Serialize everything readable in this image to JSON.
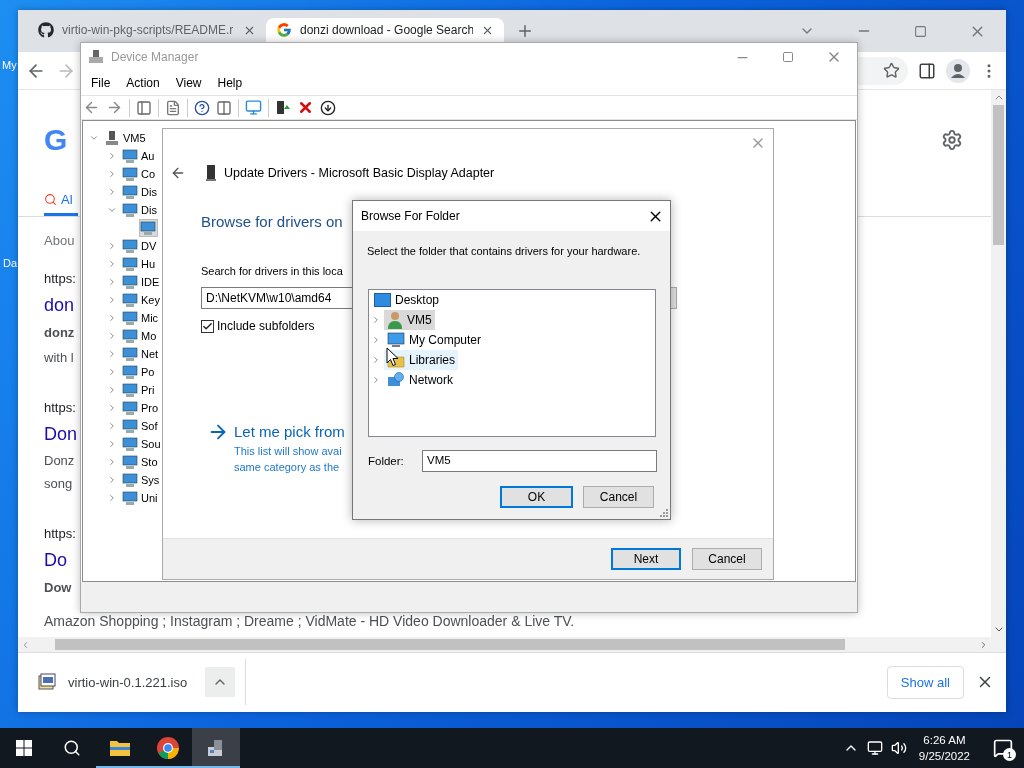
{
  "desktop_labels": [
    "My",
    "Da"
  ],
  "browser": {
    "tabs": [
      {
        "kind": "github",
        "title": "virtio-win-pkg-scripts/README.r",
        "selected": false
      },
      {
        "kind": "google",
        "title": "donzi download - Google Search",
        "selected": true
      }
    ],
    "page": {
      "logo": "G",
      "search_tab": {
        "label": "Al",
        "selected": true
      },
      "lines": [
        {
          "kind": "stats",
          "text": "Abou"
        },
        {
          "kind": "url",
          "text": "https:"
        },
        {
          "kind": "title",
          "text": "don"
        },
        {
          "kind": "bold",
          "text": "donz"
        },
        {
          "kind": "snippet",
          "text": "with l"
        },
        {
          "kind": "url",
          "text": "https:"
        },
        {
          "kind": "title",
          "text": "Don"
        },
        {
          "kind": "snippet",
          "text": "Donz"
        },
        {
          "kind": "snippet",
          "text": "song"
        },
        {
          "kind": "url",
          "text": "https:"
        },
        {
          "kind": "title",
          "text": "Do"
        },
        {
          "kind": "bold",
          "text": "Dow"
        }
      ],
      "wide_snippet": "Amazon Shopping ; Instagram ; Dreame ; VidMate - HD Video Downloader & Live TV."
    },
    "download": {
      "file": "virtio-win-0.1.221.iso",
      "show_all": "Show all"
    }
  },
  "device_manager": {
    "title": "Device Manager",
    "menu": [
      "File",
      "Action",
      "View",
      "Help"
    ],
    "tree": {
      "label": "VM5",
      "expanded": true,
      "children": [
        {
          "label": "Au",
          "expanded": false
        },
        {
          "label": "Co",
          "expanded": false
        },
        {
          "label": "Dis",
          "expanded": false
        },
        {
          "label": "Dis",
          "expanded": true,
          "children": [
            {
              "selected": true
            }
          ]
        },
        {
          "label": "DV",
          "expanded": false
        },
        {
          "label": "Hu",
          "expanded": false
        },
        {
          "label": "IDE",
          "expanded": false
        },
        {
          "label": "Key",
          "expanded": false
        },
        {
          "label": "Mic",
          "expanded": false
        },
        {
          "label": "Mo",
          "expanded": false
        },
        {
          "label": "Net",
          "expanded": false
        },
        {
          "label": "Po",
          "expanded": false
        },
        {
          "label": "Pri",
          "expanded": false
        },
        {
          "label": "Pro",
          "expanded": false
        },
        {
          "label": "Sof",
          "expanded": false
        },
        {
          "label": "Sou",
          "expanded": false
        },
        {
          "label": "Sto",
          "expanded": false
        },
        {
          "label": "Sys",
          "expanded": false
        },
        {
          "label": "Uni",
          "expanded": false
        }
      ]
    }
  },
  "update_drivers": {
    "title": "Update Drivers - Microsoft Basic Display Adapter",
    "heading": "Browse for drivers on",
    "location_label": "Search for drivers in this loca",
    "location": "D:\\NetKVM\\w10\\amd64",
    "include_subfolders": {
      "label": "Include subfolders",
      "checked": true
    },
    "pick_link": "Let me pick from",
    "pick_note": [
      "This list will show avai",
      "same category as the"
    ],
    "buttons": [
      {
        "label": "Next",
        "default": true
      },
      {
        "label": "Cancel",
        "default": false
      }
    ]
  },
  "browse_for_folder": {
    "title": "Browse For Folder",
    "instruction": "Select the folder that contains drivers for your hardware.",
    "items": [
      {
        "kind": "desktop",
        "label": "Desktop",
        "selected": false,
        "hovered": false
      },
      {
        "kind": "user",
        "label": "VM5",
        "expanded": false,
        "selected": true,
        "hovered": false
      },
      {
        "kind": "computer",
        "label": "My Computer",
        "expanded": false,
        "selected": false,
        "hovered": false
      },
      {
        "kind": "libraries",
        "label": "Libraries",
        "expanded": false,
        "selected": false,
        "hovered": true
      },
      {
        "kind": "network",
        "label": "Network",
        "expanded": false,
        "selected": false,
        "hovered": false
      }
    ],
    "folder_label": "Folder:",
    "folder": "VM5",
    "buttons": [
      {
        "label": "OK",
        "default": true
      },
      {
        "label": "Cancel",
        "default": false
      }
    ]
  },
  "taskbar": {
    "items": [
      {
        "kind": "start",
        "running": false,
        "selected": false
      },
      {
        "kind": "search",
        "running": false,
        "selected": false
      },
      {
        "kind": "explorer",
        "running": true,
        "selected": false
      },
      {
        "kind": "chrome",
        "running": true,
        "selected": false
      },
      {
        "kind": "devmgr",
        "running": true,
        "selected": true
      }
    ],
    "time": "6:26 AM",
    "date": "9/25/2022",
    "notifications": "1"
  }
}
